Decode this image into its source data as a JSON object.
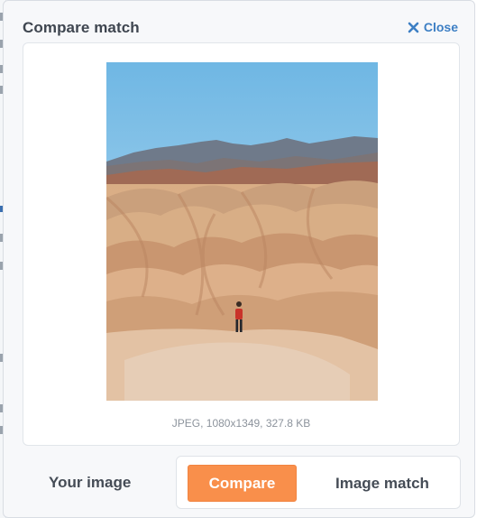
{
  "modal": {
    "title": "Compare match",
    "close_label": "Close"
  },
  "preview": {
    "file_info": "JPEG, 1080x1349, 327.8 KB",
    "image_subject": "desert badlands landscape with person standing on rock"
  },
  "footer": {
    "your_image_label": "Your image",
    "compare_label": "Compare",
    "image_match_label": "Image match"
  },
  "colors": {
    "accent_orange": "#f98f4b",
    "link_blue": "#3d7fc4",
    "title_text": "#3f4650"
  },
  "icons": {
    "close": "close-icon"
  }
}
